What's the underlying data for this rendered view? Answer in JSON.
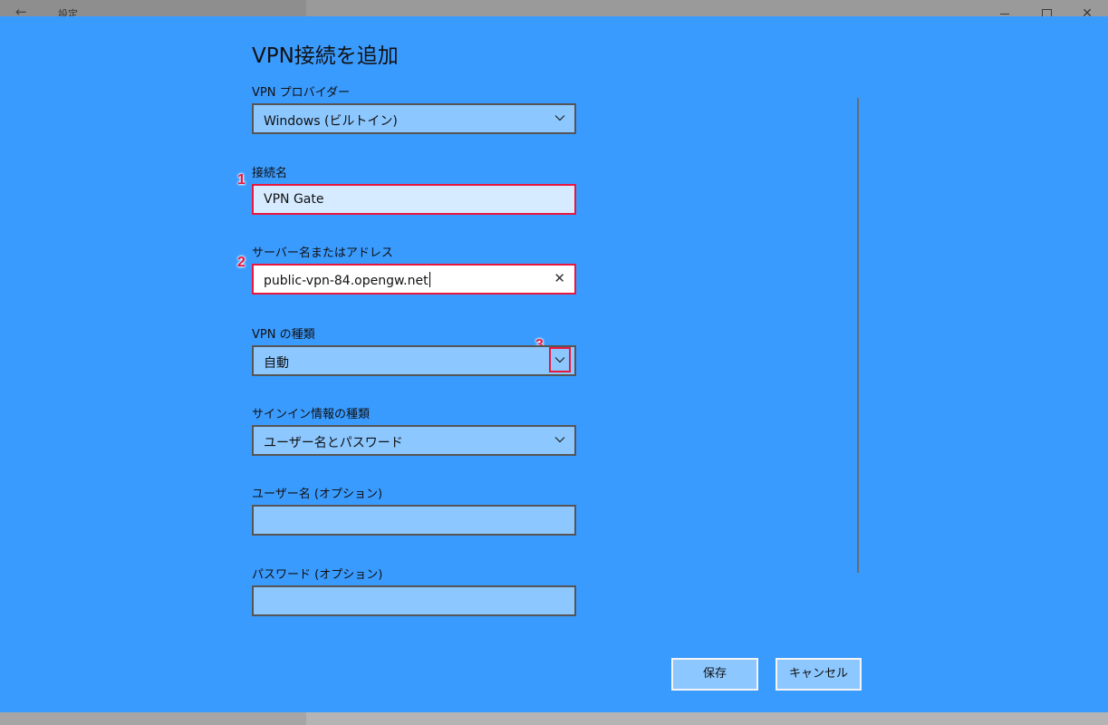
{
  "window": {
    "app_title": "設定",
    "back_icon": "back-arrow-icon",
    "close_glyph": "✕"
  },
  "dialog": {
    "title": "VPN接続を追加",
    "provider": {
      "label": "VPN プロバイダー",
      "value": "Windows (ビルトイン)"
    },
    "connection_name": {
      "label": "接続名",
      "value": "VPN Gate"
    },
    "server": {
      "label": "サーバー名またはアドレス",
      "value": "public-vpn-84.opengw.net"
    },
    "vpn_type": {
      "label": "VPN の種類",
      "value": "自動"
    },
    "signin_type": {
      "label": "サインイン情報の種類",
      "value": "ユーザー名とパスワード"
    },
    "username": {
      "label": "ユーザー名 (オプション)",
      "value": ""
    },
    "password": {
      "label": "パスワード (オプション)",
      "value": ""
    },
    "save_label": "保存",
    "cancel_label": "キャンセル"
  },
  "annotations": [
    "1",
    "2",
    "3"
  ],
  "colors": {
    "dialog_bg": "#3a9bff",
    "field_bg": "#8cc7ff",
    "highlight": "#e8173e"
  }
}
